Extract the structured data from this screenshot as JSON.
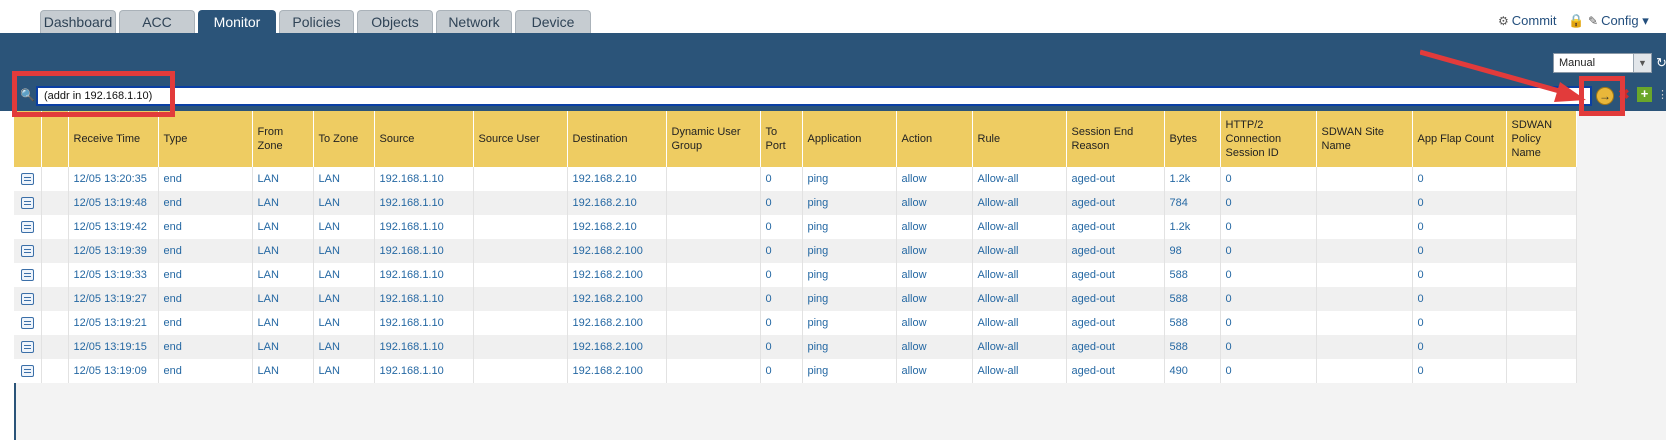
{
  "nav": {
    "tabs": [
      {
        "label": "Dashboard",
        "active": false
      },
      {
        "label": "ACC",
        "active": false
      },
      {
        "label": "Monitor",
        "active": true
      },
      {
        "label": "Policies",
        "active": false
      },
      {
        "label": "Objects",
        "active": false
      },
      {
        "label": "Network",
        "active": false
      },
      {
        "label": "Device",
        "active": false
      }
    ],
    "commit_label": "Commit",
    "config_label": "Config"
  },
  "refresh": {
    "selected": "Manual"
  },
  "filter": {
    "query": "(addr in 192.168.1.10)"
  },
  "table": {
    "columns": [
      "",
      "",
      "Receive Time",
      "Type",
      "From Zone",
      "To Zone",
      "Source",
      "Source User",
      "Destination",
      "Dynamic User Group",
      "To Port",
      "Application",
      "Action",
      "Rule",
      "Session End Reason",
      "Bytes",
      "HTTP/2 Connection Session ID",
      "SDWAN Site Name",
      "App Flap Count",
      "SDWAN Policy Name"
    ],
    "rows": [
      {
        "receive_time": "12/05 13:20:35",
        "type": "end",
        "from_zone": "LAN",
        "to_zone": "LAN",
        "source": "192.168.1.10",
        "source_user": "",
        "destination": "192.168.2.10",
        "dug": "",
        "to_port": "0",
        "application": "ping",
        "action": "allow",
        "rule": "Allow-all",
        "end_reason": "aged-out",
        "bytes": "1.2k",
        "http2": "0",
        "sdwan_site": "",
        "app_flap": "0",
        "sdwan_policy": ""
      },
      {
        "receive_time": "12/05 13:19:48",
        "type": "end",
        "from_zone": "LAN",
        "to_zone": "LAN",
        "source": "192.168.1.10",
        "source_user": "",
        "destination": "192.168.2.10",
        "dug": "",
        "to_port": "0",
        "application": "ping",
        "action": "allow",
        "rule": "Allow-all",
        "end_reason": "aged-out",
        "bytes": "784",
        "http2": "0",
        "sdwan_site": "",
        "app_flap": "0",
        "sdwan_policy": ""
      },
      {
        "receive_time": "12/05 13:19:42",
        "type": "end",
        "from_zone": "LAN",
        "to_zone": "LAN",
        "source": "192.168.1.10",
        "source_user": "",
        "destination": "192.168.2.10",
        "dug": "",
        "to_port": "0",
        "application": "ping",
        "action": "allow",
        "rule": "Allow-all",
        "end_reason": "aged-out",
        "bytes": "1.2k",
        "http2": "0",
        "sdwan_site": "",
        "app_flap": "0",
        "sdwan_policy": ""
      },
      {
        "receive_time": "12/05 13:19:39",
        "type": "end",
        "from_zone": "LAN",
        "to_zone": "LAN",
        "source": "192.168.1.10",
        "source_user": "",
        "destination": "192.168.2.100",
        "dug": "",
        "to_port": "0",
        "application": "ping",
        "action": "allow",
        "rule": "Allow-all",
        "end_reason": "aged-out",
        "bytes": "98",
        "http2": "0",
        "sdwan_site": "",
        "app_flap": "0",
        "sdwan_policy": ""
      },
      {
        "receive_time": "12/05 13:19:33",
        "type": "end",
        "from_zone": "LAN",
        "to_zone": "LAN",
        "source": "192.168.1.10",
        "source_user": "",
        "destination": "192.168.2.100",
        "dug": "",
        "to_port": "0",
        "application": "ping",
        "action": "allow",
        "rule": "Allow-all",
        "end_reason": "aged-out",
        "bytes": "588",
        "http2": "0",
        "sdwan_site": "",
        "app_flap": "0",
        "sdwan_policy": ""
      },
      {
        "receive_time": "12/05 13:19:27",
        "type": "end",
        "from_zone": "LAN",
        "to_zone": "LAN",
        "source": "192.168.1.10",
        "source_user": "",
        "destination": "192.168.2.100",
        "dug": "",
        "to_port": "0",
        "application": "ping",
        "action": "allow",
        "rule": "Allow-all",
        "end_reason": "aged-out",
        "bytes": "588",
        "http2": "0",
        "sdwan_site": "",
        "app_flap": "0",
        "sdwan_policy": ""
      },
      {
        "receive_time": "12/05 13:19:21",
        "type": "end",
        "from_zone": "LAN",
        "to_zone": "LAN",
        "source": "192.168.1.10",
        "source_user": "",
        "destination": "192.168.2.100",
        "dug": "",
        "to_port": "0",
        "application": "ping",
        "action": "allow",
        "rule": "Allow-all",
        "end_reason": "aged-out",
        "bytes": "588",
        "http2": "0",
        "sdwan_site": "",
        "app_flap": "0",
        "sdwan_policy": ""
      },
      {
        "receive_time": "12/05 13:19:15",
        "type": "end",
        "from_zone": "LAN",
        "to_zone": "LAN",
        "source": "192.168.1.10",
        "source_user": "",
        "destination": "192.168.2.100",
        "dug": "",
        "to_port": "0",
        "application": "ping",
        "action": "allow",
        "rule": "Allow-all",
        "end_reason": "aged-out",
        "bytes": "588",
        "http2": "0",
        "sdwan_site": "",
        "app_flap": "0",
        "sdwan_policy": ""
      },
      {
        "receive_time": "12/05 13:19:09",
        "type": "end",
        "from_zone": "LAN",
        "to_zone": "LAN",
        "source": "192.168.1.10",
        "source_user": "",
        "destination": "192.168.2.100",
        "dug": "",
        "to_port": "0",
        "application": "ping",
        "action": "allow",
        "rule": "Allow-all",
        "end_reason": "aged-out",
        "bytes": "490",
        "http2": "0",
        "sdwan_site": "",
        "app_flap": "0",
        "sdwan_policy": ""
      }
    ]
  },
  "colors": {
    "nav_band": "#2b5479",
    "header_row": "#eecc62",
    "link_text": "#2568a3",
    "annotation": "#e23b3b"
  },
  "icons": {
    "commit": "commit-icon",
    "lock": "lock-icon",
    "config": "config-icon",
    "search": "search-icon",
    "apply": "apply-filter-icon",
    "clear": "clear-filter-icon",
    "add": "add-filter-icon",
    "detail": "log-detail-icon"
  }
}
